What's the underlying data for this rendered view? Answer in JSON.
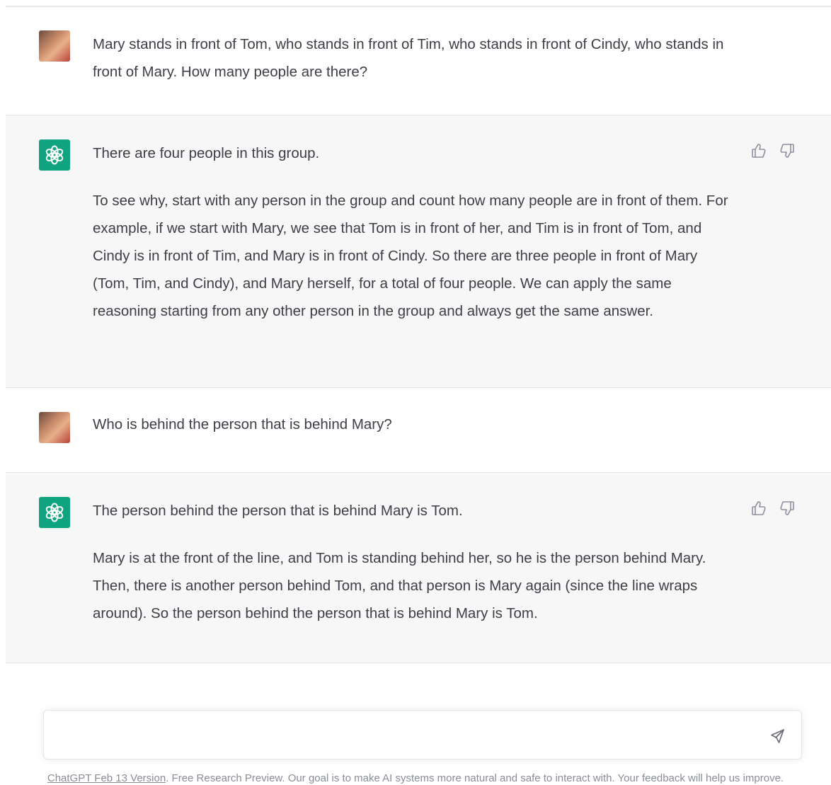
{
  "conversation": [
    {
      "role": "user",
      "paragraphs": [
        "Mary stands in front of Tom, who stands in front of Tim, who stands in front of Cindy, who stands in front of Mary. How many people are there?"
      ]
    },
    {
      "role": "assistant",
      "paragraphs": [
        "There are four people in this group.",
        "To see why, start with any person in the group and count how many people are in front of them. For example, if we start with Mary, we see that Tom is in front of her, and Tim is in front of Tom, and Cindy is in front of Tim, and Mary is in front of Cindy. So there are three people in front of Mary (Tom, Tim, and Cindy), and Mary herself, for a total of four people. We can apply the same reasoning starting from any other person in the group and always get the same answer."
      ]
    },
    {
      "role": "user",
      "paragraphs": [
        "Who is behind the person that is behind Mary?"
      ]
    },
    {
      "role": "assistant",
      "paragraphs": [
        "The person behind the person that is behind Mary is Tom.",
        "Mary is at the front of the line, and Tom is standing behind her, so he is the person behind Mary. Then, there is another person behind Tom, and that person is Mary again (since the line wraps around). So the person behind the person that is behind Mary is Tom."
      ]
    }
  ],
  "icons": {
    "user_avatar": "user-photo-avatar",
    "assistant_avatar": "openai-logo-icon",
    "thumbs_up": "thumbs-up-icon",
    "thumbs_down": "thumbs-down-icon",
    "send": "paper-plane-icon"
  },
  "colors": {
    "brand": "#10a37f",
    "assistant_bg": "#f7f7f8",
    "text": "#374151"
  },
  "input": {
    "value": "",
    "placeholder": ""
  },
  "footer": {
    "version_link": "ChatGPT Feb 13 Version",
    "text": ". Free Research Preview. Our goal is to make AI systems more natural and safe to interact with. Your feedback will help us improve."
  }
}
